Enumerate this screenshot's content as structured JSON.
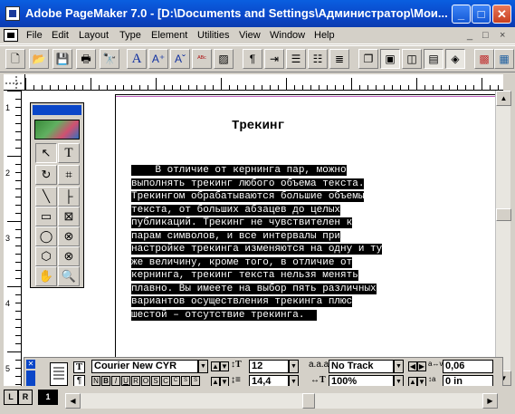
{
  "window": {
    "title": "Adobe PageMaker 7.0 - [D:\\Documents and Settings\\Администратор\\Мои...",
    "minimize": "_",
    "maximize": "□",
    "close": "✕"
  },
  "menu": {
    "items": [
      "File",
      "Edit",
      "Layout",
      "Type",
      "Element",
      "Utilities",
      "View",
      "Window",
      "Help"
    ],
    "mdi": [
      "_",
      "□",
      "×"
    ]
  },
  "toolbar": {
    "buttons": [
      {
        "name": "new-icon",
        "glyph": "🗋"
      },
      {
        "name": "open-icon",
        "glyph": "📂"
      },
      {
        "name": "save-icon",
        "glyph": "💾"
      },
      {
        "name": "print-icon",
        "glyph": "🖶"
      },
      {
        "name": "find-icon",
        "glyph": "🔭"
      },
      {
        "name": "font-icon",
        "glyph": "A"
      },
      {
        "name": "size-up-icon",
        "glyph": "A⁺"
      },
      {
        "name": "size-down-icon",
        "glyph": "Aˇ"
      },
      {
        "name": "spell-icon",
        "glyph": "ᴬᴮᶜ"
      },
      {
        "name": "fill-icon",
        "glyph": "▨"
      },
      {
        "name": "paragraph-icon",
        "glyph": "¶"
      },
      {
        "name": "indents-icon",
        "glyph": "⇥"
      },
      {
        "name": "bullets-icon",
        "glyph": "☰"
      },
      {
        "name": "numbering-icon",
        "glyph": "☷"
      },
      {
        "name": "styles-icon",
        "glyph": "≣"
      },
      {
        "name": "copy-icon",
        "glyph": "❐"
      },
      {
        "name": "paste-icon",
        "glyph": "▣"
      },
      {
        "name": "place-icon",
        "glyph": "◫"
      },
      {
        "name": "link-icon",
        "glyph": "▤"
      },
      {
        "name": "layers-icon",
        "glyph": "◈"
      },
      {
        "name": "color-icon",
        "glyph": "▩"
      },
      {
        "name": "book-icon",
        "glyph": "▦"
      }
    ]
  },
  "ruler": {
    "v_marks": [
      "1",
      "2",
      "3",
      "4",
      "5"
    ]
  },
  "document": {
    "heading": "Трекинг",
    "body_lines": [
      "    В отличие от кернинга пар, можно",
      "выполнять трекинг любого объема текста.",
      "Трекингом обрабатываются большие объемы",
      "текста, от больших абзацев до целых",
      "публикаций. Трекинг не чувствителен к",
      "парам символов, и все интервалы при",
      "настройке трекинга изменяются на одну и ту",
      "же величину, кроме того, в отличие от",
      "кернинга, трекинг текста нельзя менять",
      "плавно. Вы имеете на выбор пять различных",
      "вариантов осуществления трекинга плюс",
      "шестой – отсутствие трекинга.  "
    ]
  },
  "toolbox": {
    "tools": [
      {
        "name": "pointer-tool",
        "glyph": "↖"
      },
      {
        "name": "text-tool",
        "glyph": "T"
      },
      {
        "name": "rotate-tool",
        "glyph": "↻"
      },
      {
        "name": "crop-tool",
        "glyph": "⌗"
      },
      {
        "name": "line-tool",
        "glyph": "╲"
      },
      {
        "name": "constrained-line-tool",
        "glyph": "├"
      },
      {
        "name": "rectangle-tool",
        "glyph": "▭"
      },
      {
        "name": "rectangle-frame-tool",
        "glyph": "⊠"
      },
      {
        "name": "ellipse-tool",
        "glyph": "◯"
      },
      {
        "name": "ellipse-frame-tool",
        "glyph": "⊗"
      },
      {
        "name": "polygon-tool",
        "glyph": "⬡"
      },
      {
        "name": "polygon-frame-tool",
        "glyph": "⊗"
      },
      {
        "name": "hand-tool",
        "glyph": "✋"
      },
      {
        "name": "zoom-tool",
        "glyph": "🔍"
      }
    ]
  },
  "control_palette": {
    "font": "Courier New CYR",
    "size": "12",
    "leading": "14,4",
    "track": "No Track",
    "width": "100%",
    "kerning": "0,06",
    "baseline_shift": "0 in",
    "style_buttons": [
      "N",
      "B",
      "I",
      "U",
      "R",
      "O",
      "S",
      "C",
      "C",
      "S",
      "S"
    ]
  },
  "pages": {
    "left": "L",
    "right": "R",
    "current": "1"
  }
}
